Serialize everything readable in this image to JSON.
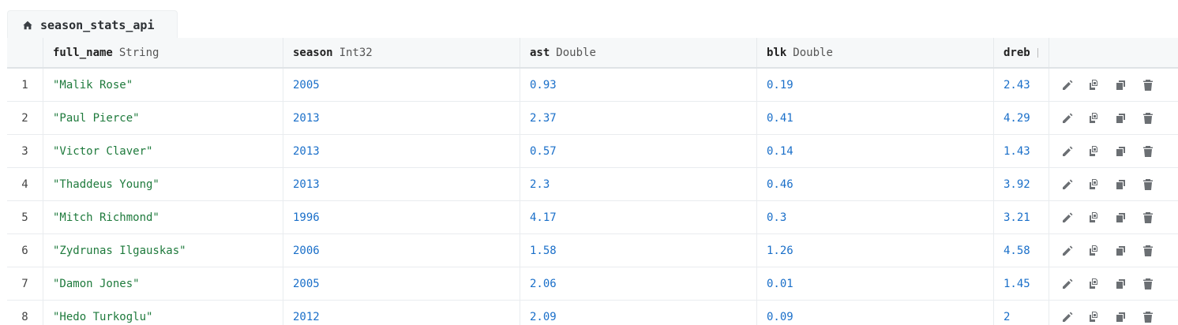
{
  "tab": {
    "title": "season_stats_api",
    "icon": "home-icon"
  },
  "columns": [
    {
      "name": "full_name",
      "type": "String"
    },
    {
      "name": "season",
      "type": "Int32"
    },
    {
      "name": "ast",
      "type": "Double"
    },
    {
      "name": "blk",
      "type": "Double"
    },
    {
      "name": "dreb",
      "type": ""
    }
  ],
  "row_actions": [
    "edit-icon",
    "duplicate-icon",
    "copy-icon",
    "delete-icon"
  ],
  "rows": [
    {
      "index": "1",
      "full_name": "\"Malik Rose\"",
      "season": "2005",
      "ast": "0.93",
      "blk": "0.19",
      "dreb": "2.43"
    },
    {
      "index": "2",
      "full_name": "\"Paul Pierce\"",
      "season": "2013",
      "ast": "2.37",
      "blk": "0.41",
      "dreb": "4.29"
    },
    {
      "index": "3",
      "full_name": "\"Victor Claver\"",
      "season": "2013",
      "ast": "0.57",
      "blk": "0.14",
      "dreb": "1.43"
    },
    {
      "index": "4",
      "full_name": "\"Thaddeus Young\"",
      "season": "2013",
      "ast": "2.3",
      "blk": "0.46",
      "dreb": "3.92"
    },
    {
      "index": "5",
      "full_name": "\"Mitch Richmond\"",
      "season": "1996",
      "ast": "4.17",
      "blk": "0.3",
      "dreb": "3.21"
    },
    {
      "index": "6",
      "full_name": "\"Zydrunas Ilgauskas\"",
      "season": "2006",
      "ast": "1.58",
      "blk": "1.26",
      "dreb": "4.58"
    },
    {
      "index": "7",
      "full_name": "\"Damon Jones\"",
      "season": "2005",
      "ast": "2.06",
      "blk": "0.01",
      "dreb": "1.45"
    },
    {
      "index": "8",
      "full_name": "\"Hedo Turkoglu\"",
      "season": "2012",
      "ast": "2.09",
      "blk": "0.09",
      "dreb": "2"
    }
  ]
}
